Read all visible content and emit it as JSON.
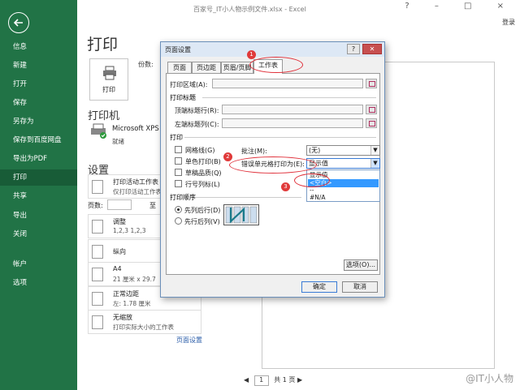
{
  "window": {
    "title": "百家号_IT小人物示例文件.xlsx - Excel",
    "controls": "? – □ ×",
    "login": "登录"
  },
  "nav": {
    "items": [
      {
        "label": "信息"
      },
      {
        "label": "新建"
      },
      {
        "label": "打开"
      },
      {
        "label": "保存"
      },
      {
        "label": "另存为"
      },
      {
        "label": "保存到百度网盘"
      },
      {
        "label": "导出为PDF"
      },
      {
        "label": "打印",
        "active": true
      },
      {
        "label": "共享"
      },
      {
        "label": "导出"
      },
      {
        "label": "关闭"
      },
      {
        "label": "帐户"
      },
      {
        "label": "选项"
      }
    ]
  },
  "backstage": {
    "page_title": "打印",
    "print_button": "打印",
    "copies_label": "份数:",
    "printer_section": "打印机",
    "printer_name": "Microsoft XPS",
    "printer_status": "就绪",
    "settings_section": "设置",
    "settings": [
      {
        "line1": "打印活动工作表",
        "line2": "仅打印活动工作表"
      },
      {
        "line1": "调整",
        "line2": "1,2,3    1,2,3"
      },
      {
        "line1": "纵向",
        "line2": ""
      },
      {
        "line1": "A4",
        "line2": "21 厘米 x 29.7"
      },
      {
        "line1": "正常边距",
        "line2": "左: 1.78 厘米"
      },
      {
        "line1": "无缩放",
        "line2": "打印实际大小的工作表"
      }
    ],
    "pages_label": "页数:",
    "pages_to": "至",
    "page_setup_link": "页面设置",
    "pager": {
      "current": "1",
      "of": "共 1 页"
    }
  },
  "dialog": {
    "title": "页面设置",
    "help": "?",
    "close": "✕",
    "tabs": [
      {
        "label": "页面"
      },
      {
        "label": "页边距"
      },
      {
        "label": "页眉/页脚"
      },
      {
        "label": "工作表",
        "active": true
      }
    ],
    "print_area_label": "打印区域(A):",
    "print_titles_group": "打印标题",
    "top_title_rows_label": "顶端标题行(R):",
    "left_title_cols_label": "左端标题列(C):",
    "print_group": "打印",
    "checks": [
      {
        "label": "网格线(G)"
      },
      {
        "label": "单色打印(B)"
      },
      {
        "label": "草稿品质(Q)"
      },
      {
        "label": "行号列标(L)"
      }
    ],
    "comments_label": "批注(M):",
    "comments_value": "(无)",
    "errors_label": "错误单元格打印为(E):",
    "errors_value": "显示值",
    "error_options": [
      "显示值",
      "<空白>",
      "--",
      "#N/A"
    ],
    "error_selected": "<空白>",
    "order_group": "打印顺序",
    "order_options": [
      {
        "label": "先列后行(D)",
        "checked": true
      },
      {
        "label": "先行后列(V)",
        "checked": false
      }
    ],
    "options_button": "选项(O)...",
    "ok_button": "确定",
    "cancel_button": "取消"
  },
  "annotations": {
    "steps": [
      "1",
      "2",
      "3"
    ]
  },
  "watermark": "@IT小人物"
}
